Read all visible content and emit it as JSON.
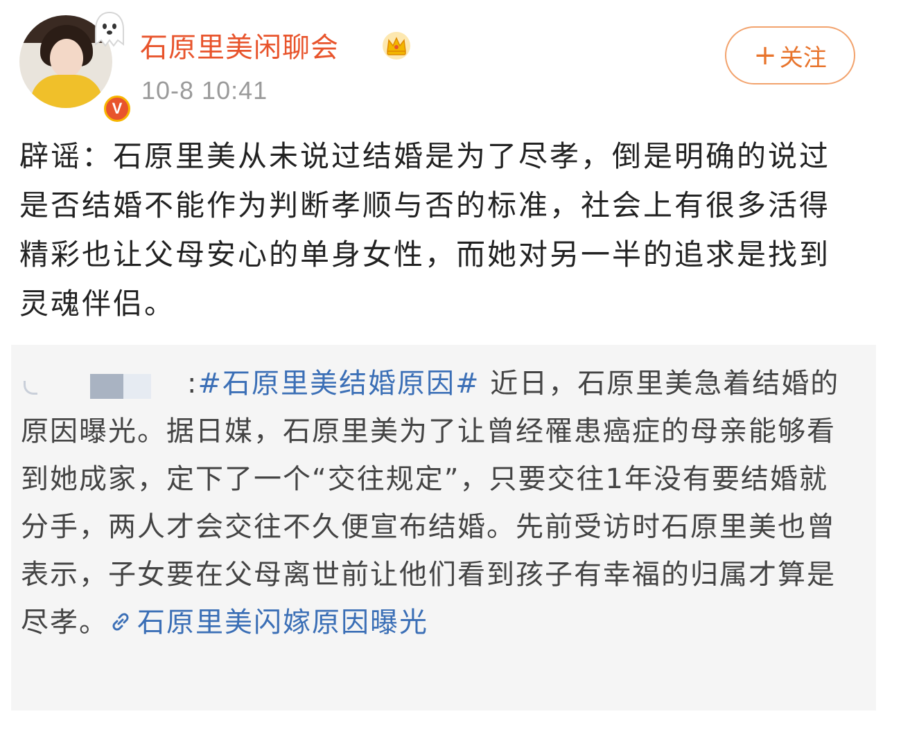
{
  "user": {
    "name": "石原里美闲聊会",
    "timestamp": "10-8 10:41",
    "verified_badge": "V"
  },
  "follow_button": {
    "plus": "+",
    "label": "关注"
  },
  "post": {
    "text": "辟谣：石原里美从未说过结婚是为了尽孝，倒是明确的说过是否结婚不能作为判断孝顺与否的标准，社会上有很多活得精彩也让父母安心的单身女性，而她对另一半的追求是找到灵魂伴侣。"
  },
  "repost": {
    "separator": ":",
    "hashtag": "#石原里美结婚原因#",
    "text": " 近日，石原里美急着结婚的原因曝光。据日媒，石原里美为了让曾经罹患癌症的母亲能够看到她成家，定下了一个“交往规定”，只要交往1年没有要结婚就分手，两人才会交往不久便宣布结婚。先前受访时石原里美也曾表示，子女要在父母离世前让他们看到孩子有幸福的归属才算是尽孝。",
    "link_text": "石原里美闪嫁原因曝光"
  },
  "colors": {
    "username": "#e8542c",
    "hashtag": "#3b6fb6",
    "repost_bg": "#f5f5f5",
    "follow_border": "#f2a26c"
  },
  "icons": {
    "avatar_decoration": "ghost-icon",
    "membership": "crown-icon",
    "verified": "verified-badge-icon",
    "link": "link-icon"
  }
}
